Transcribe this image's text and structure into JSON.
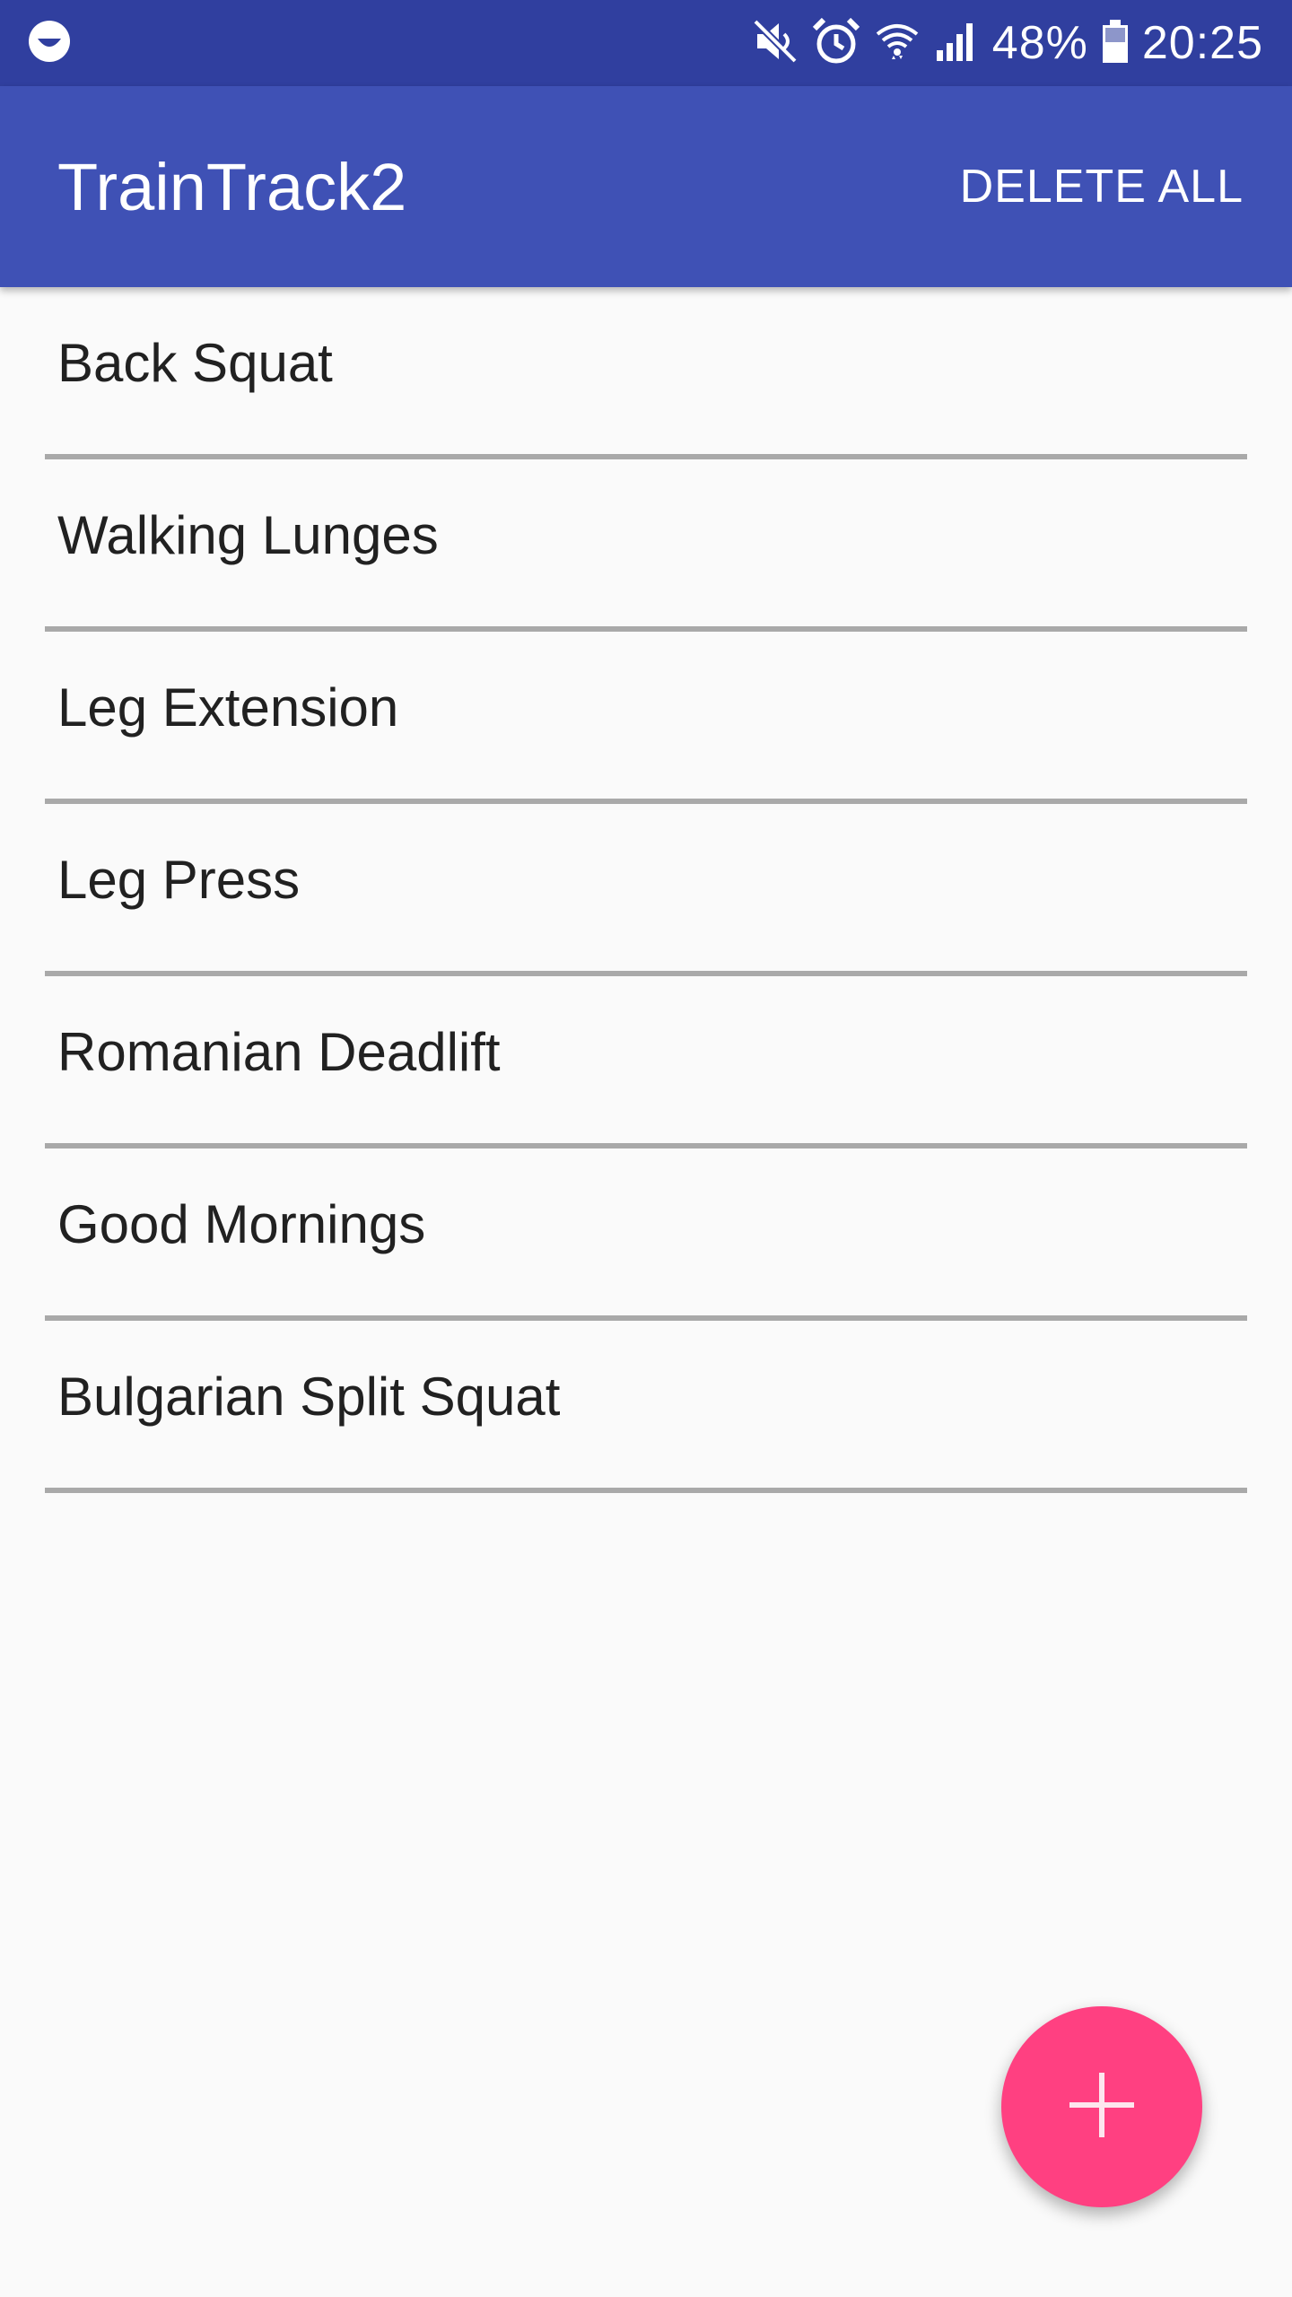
{
  "status_bar": {
    "notification_icon": "smiley-icon",
    "icons": [
      "mute-icon",
      "alarm-icon",
      "wifi-icon",
      "signal-icon"
    ],
    "battery_percent": "48%",
    "time": "20:25"
  },
  "app_bar": {
    "title": "TrainTrack2",
    "delete_all_label": "DELETE ALL"
  },
  "exercises": [
    {
      "label": "Back Squat"
    },
    {
      "label": "Walking Lunges"
    },
    {
      "label": "Leg Extension"
    },
    {
      "label": "Leg Press"
    },
    {
      "label": "Romanian Deadlift"
    },
    {
      "label": "Good Mornings"
    },
    {
      "label": "Bulgarian Split Squat"
    }
  ],
  "fab": {
    "icon": "plus-icon"
  },
  "colors": {
    "status_bar": "#303f9f",
    "primary": "#3f51b5",
    "accent": "#ff4081",
    "background": "#fafafa",
    "divider": "#a9a9a9"
  }
}
